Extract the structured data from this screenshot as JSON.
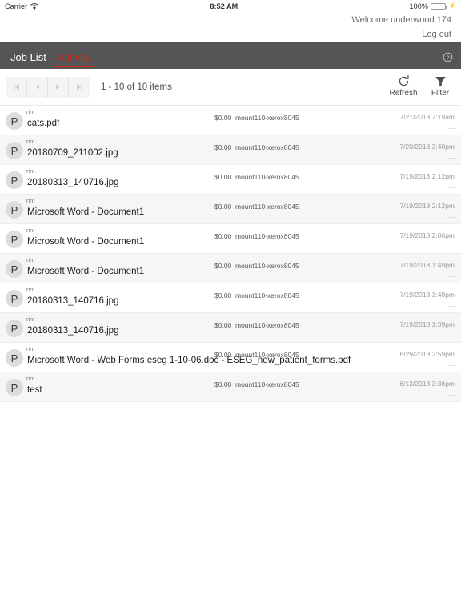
{
  "statusbar": {
    "carrier": "Carrier",
    "wifi_icon": "wifi-icon",
    "time": "8:52 AM",
    "battery_percent": "100%",
    "battery_icon": "battery-icon",
    "charging_icon": "lightning-bolt-icon"
  },
  "header": {
    "welcome": "Welcome underwood.174",
    "logout_label": "Log out"
  },
  "nav": {
    "tabs": [
      {
        "label": "Job List",
        "active": false
      },
      {
        "label": "Activity",
        "active": true
      }
    ],
    "help_icon": "help-circle-icon",
    "accent_color": "#d42a1e",
    "bar_color": "#555555"
  },
  "toolbar": {
    "pager": [
      {
        "name": "first-page-button",
        "icon": "first-page-icon",
        "enabled": false
      },
      {
        "name": "previous-page-button",
        "icon": "chevron-left-icon",
        "enabled": false
      },
      {
        "name": "next-page-button",
        "icon": "chevron-right-icon",
        "enabled": false
      },
      {
        "name": "last-page-button",
        "icon": "last-page-icon",
        "enabled": false
      }
    ],
    "pager_info": "1 - 10 of 10 items",
    "refresh_label": "Refresh",
    "refresh_icon": "refresh-icon",
    "filter_label": "Filter",
    "filter_icon": "funnel-icon"
  },
  "jobs": {
    "menu_glyph": "...",
    "avatar_letter": "P",
    "rows": [
      {
        "type": "rint",
        "name": "cats.pdf",
        "cost": "$0.00",
        "device": "mount110-xerox8045",
        "date": "7/27/2018 7:19am"
      },
      {
        "type": "rint",
        "name": "20180709_211002.jpg",
        "cost": "$0.00",
        "device": "mount110-xerox8045",
        "date": "7/20/2018 3:40pm"
      },
      {
        "type": "rint",
        "name": "20180313_140716.jpg",
        "cost": "$0.00",
        "device": "mount110-xerox8045",
        "date": "7/19/2018 2:12pm"
      },
      {
        "type": "rint",
        "name": "Microsoft Word - Document1",
        "cost": "$0.00",
        "device": "mount110-xerox8045",
        "date": "7/19/2018 2:12pm"
      },
      {
        "type": "rint",
        "name": "Microsoft Word - Document1",
        "cost": "$0.00",
        "device": "mount110-xerox8045",
        "date": "7/19/2018 2:06pm"
      },
      {
        "type": "rint",
        "name": "Microsoft Word - Document1",
        "cost": "$0.00",
        "device": "mount110-xerox8045",
        "date": "7/19/2018 1:49pm"
      },
      {
        "type": "rint",
        "name": "20180313_140716.jpg",
        "cost": "$0.00",
        "device": "mount110-xerox8045",
        "date": "7/19/2018 1:48pm"
      },
      {
        "type": "rint",
        "name": "20180313_140716.jpg",
        "cost": "$0.00",
        "device": "mount110-xerox8045",
        "date": "7/19/2018 1:39pm"
      },
      {
        "type": "rint",
        "name": "Microsoft Word - Web Forms eseg 1-10-06.doc - ESEG_new_patient_forms.pdf",
        "cost": "$0.00",
        "device": "mount110-xerox8045",
        "date": "6/29/2018 2:59pm"
      },
      {
        "type": "rint",
        "name": "test",
        "cost": "$0.00",
        "device": "mount110-xerox8045",
        "date": "6/13/2018 3:36pm"
      }
    ]
  }
}
